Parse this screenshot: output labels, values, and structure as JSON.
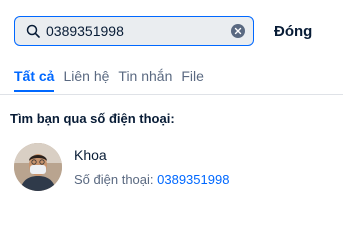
{
  "search": {
    "value": "0389351998",
    "close_label": "Đóng"
  },
  "tabs": [
    {
      "label": "Tất cả",
      "active": true
    },
    {
      "label": "Liên hệ",
      "active": false
    },
    {
      "label": "Tin nhắn",
      "active": false
    },
    {
      "label": "File",
      "active": false
    }
  ],
  "section_title": "Tìm bạn qua số điện thoại:",
  "result": {
    "name": "Khoa",
    "phone_label": "Số điện thoại: ",
    "phone": "0389351998"
  },
  "colors": {
    "accent": "#0068ff",
    "text": "#081c36",
    "muted": "#5a6981"
  }
}
